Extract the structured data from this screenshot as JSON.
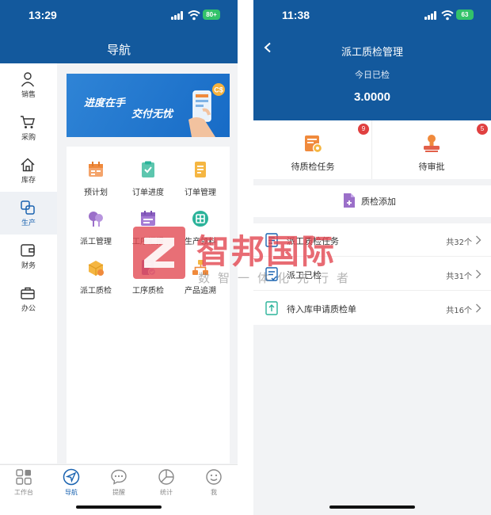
{
  "left": {
    "status": {
      "time": "13:29",
      "battery": "80+"
    },
    "header": {
      "title": "导航"
    },
    "sidebar": [
      {
        "label": "销售",
        "icon": "person-icon"
      },
      {
        "label": "采购",
        "icon": "cart-icon"
      },
      {
        "label": "库存",
        "icon": "house-icon"
      },
      {
        "label": "生产",
        "icon": "production-icon",
        "active": true
      },
      {
        "label": "财务",
        "icon": "wallet-icon"
      },
      {
        "label": "办公",
        "icon": "briefcase-icon"
      }
    ],
    "banner": {
      "line1": "进度在手",
      "line2": "交付无忧",
      "badge": "C$"
    },
    "grid": [
      {
        "label": "预计划",
        "icon": "plan-icon"
      },
      {
        "label": "订单进度",
        "icon": "order-progress-icon"
      },
      {
        "label": "订单管理",
        "icon": "order-manage-icon"
      },
      {
        "label": "派工管理",
        "icon": "dispatch-manage-icon"
      },
      {
        "label": "工序汇报",
        "icon": "process-report-icon"
      },
      {
        "label": "生产领料",
        "icon": "material-icon"
      },
      {
        "label": "派工质检",
        "icon": "dispatch-qc-icon"
      },
      {
        "label": "工序质检",
        "icon": "process-qc-icon"
      },
      {
        "label": "产品追溯",
        "icon": "trace-icon"
      }
    ],
    "tabs": [
      {
        "label": "工作台",
        "icon": "workbench-icon"
      },
      {
        "label": "导航",
        "icon": "navigation-icon",
        "active": true
      },
      {
        "label": "提醒",
        "icon": "chat-icon"
      },
      {
        "label": "统计",
        "icon": "stats-icon"
      },
      {
        "label": "我",
        "icon": "face-icon"
      }
    ]
  },
  "right": {
    "status": {
      "time": "11:38",
      "battery": "63"
    },
    "header": {
      "title": "派工质检管理",
      "subtitle": "今日已检",
      "value": "3.0000"
    },
    "cards": [
      {
        "label": "待质检任务",
        "badge": "9",
        "icon": "qc-task-icon"
      },
      {
        "label": "待审批",
        "badge": "5",
        "icon": "stamp-icon"
      }
    ],
    "add": {
      "label": "质检添加"
    },
    "list": [
      {
        "label": "派工质检任务",
        "count": "共32个"
      },
      {
        "label": "派工已检",
        "count": "共31个"
      },
      {
        "label": "待入库申请质检单",
        "count": "共16个"
      }
    ]
  },
  "watermark": {
    "name": "智邦国际",
    "slogan": "数智一体化先行者"
  },
  "colors": {
    "header": "#13599d",
    "accent": "#1a63b0",
    "badge": "#e04040",
    "icon_orange": "#f08a3c",
    "icon_purple": "#9b6fc9",
    "icon_teal": "#2bb39a"
  }
}
